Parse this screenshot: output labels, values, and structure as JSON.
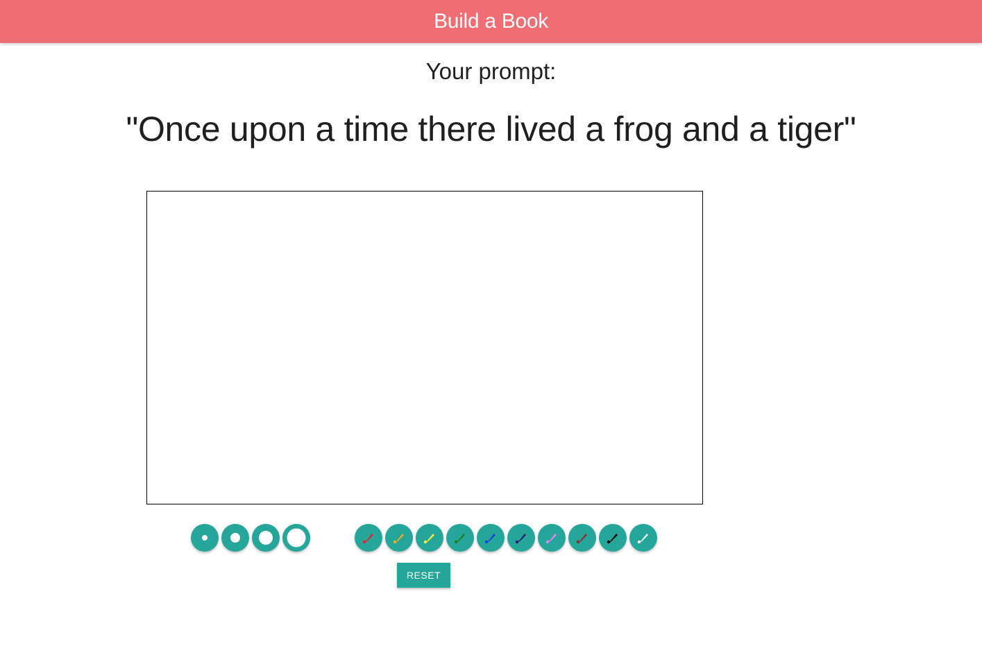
{
  "header": {
    "title": "Build a Book",
    "background_color": "#ee6e73"
  },
  "prompt": {
    "label": "Your prompt:",
    "text": "\"Once upon a time there lived a frog and a tiger\""
  },
  "toolbar": {
    "accent_color": "#26a69a",
    "brush_sizes": [
      "small",
      "medium",
      "large",
      "extra-large"
    ],
    "colors": [
      {
        "name": "red",
        "hex": "#e3242b",
        "icon": "brush-icon"
      },
      {
        "name": "orange",
        "hex": "#f5a623",
        "icon": "brush-icon"
      },
      {
        "name": "yellow",
        "hex": "#ffeb3b",
        "icon": "brush-icon"
      },
      {
        "name": "green",
        "hex": "#1e7d1e",
        "icon": "brush-icon"
      },
      {
        "name": "blue",
        "hex": "#1a3de0",
        "icon": "brush-icon"
      },
      {
        "name": "indigo",
        "hex": "#2c1d6b",
        "icon": "brush-icon"
      },
      {
        "name": "violet",
        "hex": "#ee82ee",
        "icon": "brush-icon"
      },
      {
        "name": "brown",
        "hex": "#8b2e2e",
        "icon": "brush-icon"
      },
      {
        "name": "black",
        "hex": "#000000",
        "icon": "brush-icon"
      },
      {
        "name": "white",
        "hex": "#ffffff",
        "icon": "brush-icon"
      }
    ],
    "reset_label": "RESET"
  }
}
